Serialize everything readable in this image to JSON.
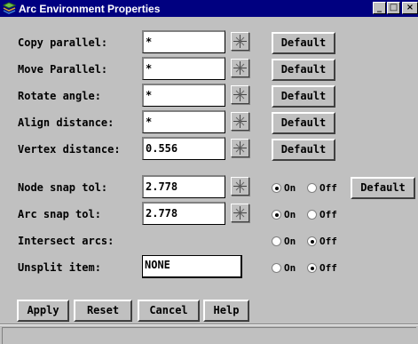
{
  "window": {
    "title": "Arc Environment Properties",
    "icon": "map-layers-icon",
    "controls": {
      "minimize": "_",
      "maximize": "□",
      "close": "×"
    }
  },
  "rows": [
    {
      "label": "Copy parallel:",
      "value": "*",
      "default_label": "Default"
    },
    {
      "label": "Move Parallel:",
      "value": "*",
      "default_label": "Default"
    },
    {
      "label": "Rotate angle:",
      "value": "*",
      "default_label": "Default"
    },
    {
      "label": "Align distance:",
      "value": "*",
      "default_label": "Default"
    },
    {
      "label": "Vertex distance:",
      "value": "0.556",
      "default_label": "Default"
    }
  ],
  "snap_rows": [
    {
      "label": "Node snap tol:",
      "value": "2.778",
      "on_label": "On",
      "off_label": "Off",
      "selected": "On",
      "default_label": "Default"
    },
    {
      "label": "Arc snap tol:",
      "value": "2.778",
      "on_label": "On",
      "off_label": "Off",
      "selected": "On"
    }
  ],
  "intersect": {
    "label": "Intersect arcs:",
    "on_label": "On",
    "off_label": "Off",
    "selected": "Off"
  },
  "unsplit": {
    "label": "Unsplit item:",
    "value": "NONE",
    "on_label": "On",
    "off_label": "Off",
    "selected": "Off"
  },
  "buttons": {
    "apply": "Apply",
    "reset": "Reset",
    "cancel": "Cancel",
    "help": "Help"
  },
  "snap_icon": "crosshair-icon",
  "colors": {
    "titlebar": "#000080",
    "face": "#c0c0c0"
  }
}
